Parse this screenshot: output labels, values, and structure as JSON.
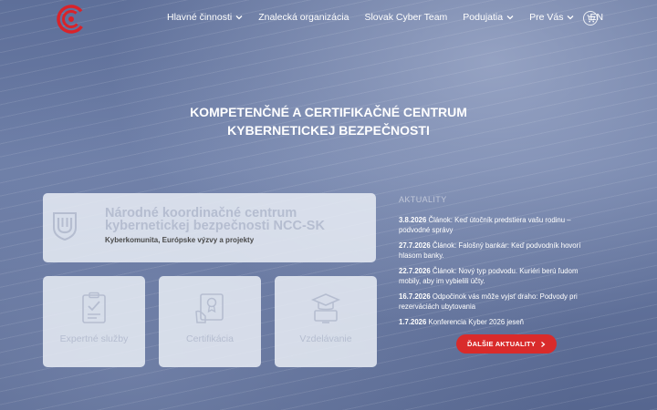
{
  "header": {
    "logo_icon": "c-logo-icon",
    "brand_color": "#d9232a",
    "nav": [
      {
        "label": "Hlavné činnosti",
        "has_dropdown": true
      },
      {
        "label": "Znalecká organizácia",
        "has_dropdown": false
      },
      {
        "label": "Slovak Cyber Team",
        "has_dropdown": false
      },
      {
        "label": "Podujatia",
        "has_dropdown": true
      },
      {
        "label": "Pre Vás",
        "has_dropdown": true
      },
      {
        "label": "EN",
        "has_dropdown": false
      }
    ],
    "cart_icon": "cart-icon"
  },
  "hero": {
    "title_line1": "KOMPETENČNÉ A CERTIFIKAČNÉ CENTRUM",
    "title_line2": "KYBERNETICKEJ BEZPEČNOSTI"
  },
  "feature_card": {
    "icon": "ncc-shield-icon",
    "title_line1": "Národné koordinačné centrum",
    "title_line2": "kybernetickej bezpečnosti NCC-SK",
    "subtitle": "Kyberkomunita, Európske výzvy a projekty"
  },
  "service_cards": [
    {
      "icon": "clipboard-check-icon",
      "label": "Expertné služby"
    },
    {
      "icon": "certificate-icon",
      "label": "Certifikácia"
    },
    {
      "icon": "education-icon",
      "label": "Vzdelávanie"
    }
  ],
  "news": {
    "heading": "AKTUALITY",
    "items": [
      {
        "date": "3.8.2026",
        "text": " Článok: Keď útočník predstiera vašu rodinu – podvodné správy"
      },
      {
        "date": "27.7.2026",
        "text": " Článok: Falošný bankár: Keď podvodník hovorí hlasom banky."
      },
      {
        "date": "22.7.2026",
        "text": " Článok: Nový typ podvodu. Kuriéri berú ľudom mobily, aby im vybielili účty."
      },
      {
        "date": "16.7.2026",
        "text": " Odpočinok vás môže vyjsť draho: Podvody pri rezerváciách ubytovania"
      },
      {
        "date": "1.7.2026",
        "text": " Konferencia Kyber 2026 jeseň"
      }
    ],
    "more_button": "ĎALŠIE AKTUALITY",
    "button_color": "#d92b2b"
  }
}
